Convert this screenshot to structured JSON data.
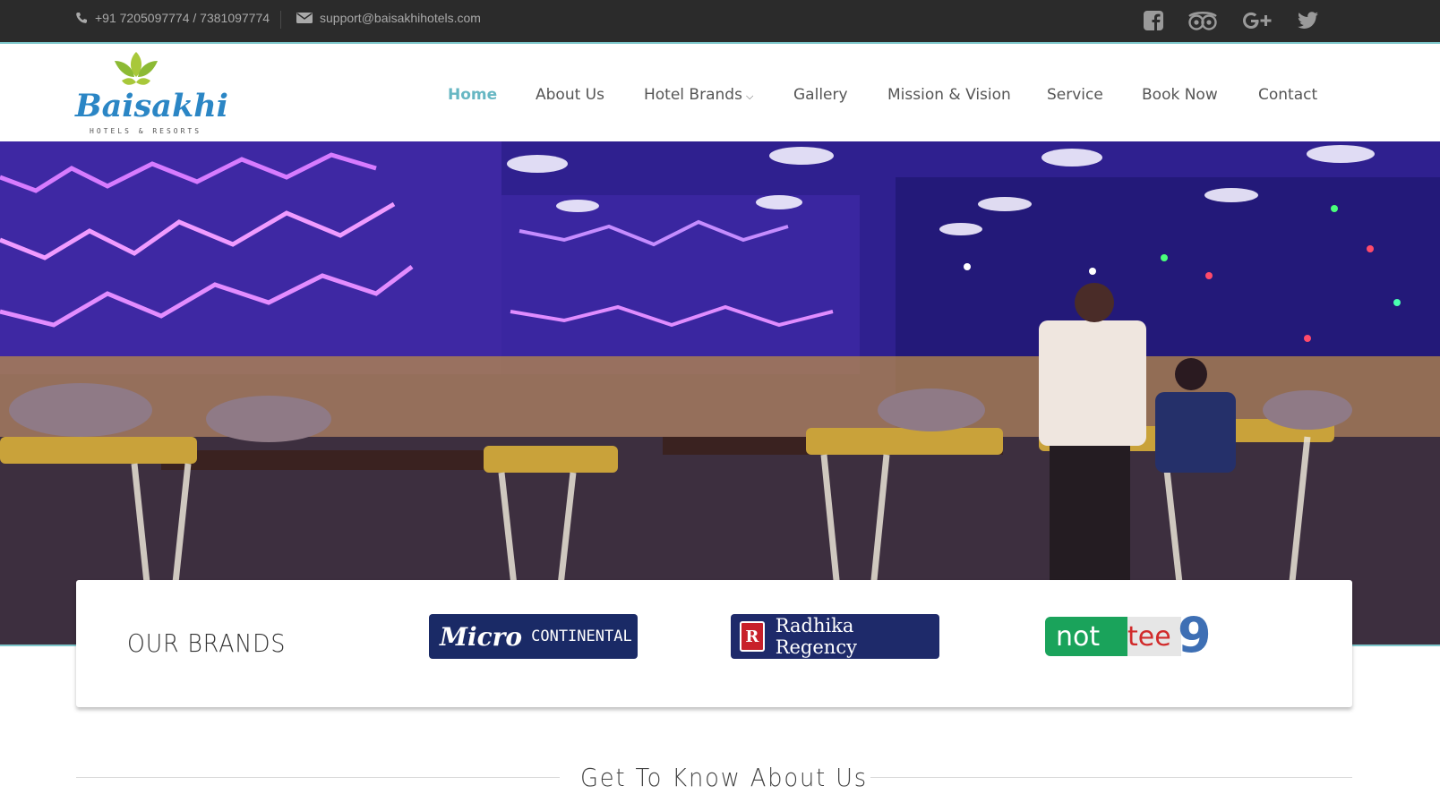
{
  "topbar": {
    "phone": "+91 7205097774 / 7381097774",
    "email": "support@baisakhihotels.com",
    "social": [
      "facebook-icon",
      "tripadvisor-icon",
      "google-plus-icon",
      "twitter-icon"
    ]
  },
  "header": {
    "logo_word": "Baisakhi",
    "logo_sub": "HOTELS & RESORTS",
    "nav": [
      {
        "label": "Home",
        "active": true
      },
      {
        "label": "About Us"
      },
      {
        "label": "Hotel Brands",
        "dropdown": true
      },
      {
        "label": "Gallery"
      },
      {
        "label": "Mission & Vision"
      },
      {
        "label": "Service"
      },
      {
        "label": "Book Now"
      },
      {
        "label": "Contact"
      }
    ]
  },
  "brands": {
    "title": "OUR BRANDS",
    "micro_a": "Micro",
    "micro_b": "CONTINENTAL",
    "radhika_mark": "R",
    "radhika_text": "Radhika Regency",
    "nottee_a": "not",
    "nottee_b": "tee",
    "nottee_c": "9"
  },
  "about": {
    "title": "Get To Know About Us"
  },
  "colors": {
    "topbar": "#2b2b2b",
    "accent": "#67b7c3",
    "nav_text": "#555555"
  }
}
